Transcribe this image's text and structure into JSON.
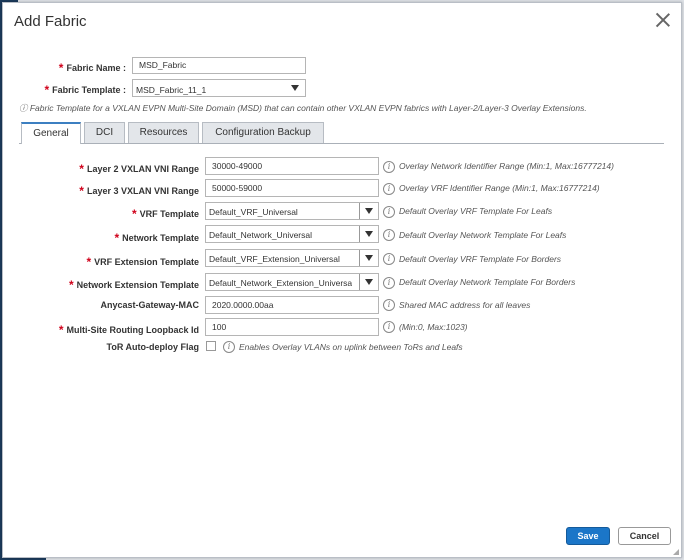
{
  "dialog": {
    "title": "Add Fabric",
    "fabric_name_label": "Fabric Name :",
    "fabric_name_value": "MSD_Fabric",
    "fabric_template_label": "Fabric Template :",
    "fabric_template_value": "MSD_Fabric_11_1",
    "template_note": "ⓘ Fabric Template for a VXLAN EVPN Multi-Site Domain (MSD) that can contain other VXLAN EVPN fabrics with Layer-2/Layer-3 Overlay Extensions.",
    "required_mark": "*",
    "info_glyph": "i",
    "save_label": "Save",
    "cancel_label": "Cancel"
  },
  "tabs": [
    "General",
    "DCI",
    "Resources",
    "Configuration Backup"
  ],
  "general": {
    "l2_vni_label": "Layer 2 VXLAN VNI Range",
    "l2_vni_value": "30000-49000",
    "l2_vni_help": "Overlay Network Identifier Range (Min:1, Max:16777214)",
    "l3_vni_label": "Layer 3 VXLAN VNI Range",
    "l3_vni_value": "50000-59000",
    "l3_vni_help": "Overlay VRF Identifier Range (Min:1, Max:16777214)",
    "vrf_template_label": "VRF Template",
    "vrf_template_value": "Default_VRF_Universal",
    "vrf_template_help": "Default Overlay VRF Template For Leafs",
    "network_template_label": "Network Template",
    "network_template_value": "Default_Network_Universal",
    "network_template_help": "Default Overlay Network Template For Leafs",
    "vrf_ext_template_label": "VRF Extension Template",
    "vrf_ext_template_value": "Default_VRF_Extension_Universal",
    "vrf_ext_template_help": "Default Overlay VRF Template For Borders",
    "net_ext_template_label": "Network Extension Template",
    "net_ext_template_value": "Default_Network_Extension_Universal",
    "net_ext_template_help": "Default Overlay Network Template For Borders",
    "anycast_mac_label": "Anycast-Gateway-MAC",
    "anycast_mac_value": "2020.0000.00aa",
    "anycast_mac_help": "Shared MAC address for all leaves",
    "loopback_label": "Multi-Site Routing Loopback Id",
    "loopback_value": "100",
    "loopback_help": "(Min:0, Max:1023)",
    "tor_label": "ToR Auto-deploy Flag",
    "tor_help": "Enables Overlay VLANs on uplink between ToRs and Leafs"
  }
}
